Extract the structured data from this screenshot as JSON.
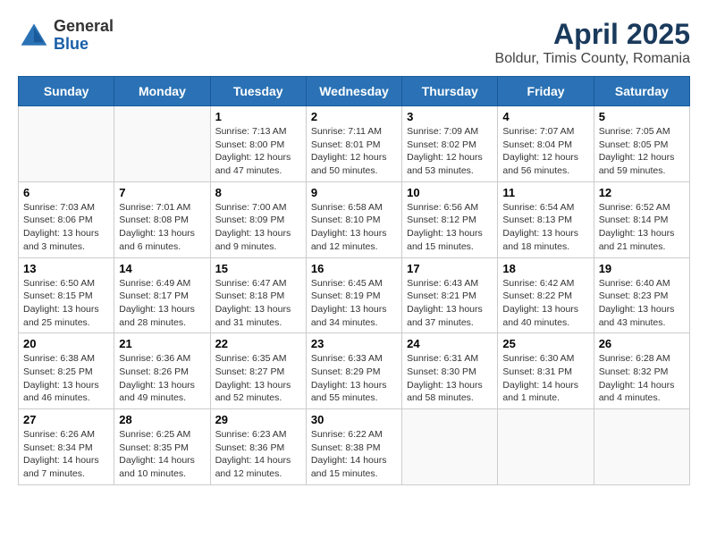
{
  "header": {
    "logo_general": "General",
    "logo_blue": "Blue",
    "title": "April 2025",
    "subtitle": "Boldur, Timis County, Romania"
  },
  "weekdays": [
    "Sunday",
    "Monday",
    "Tuesday",
    "Wednesday",
    "Thursday",
    "Friday",
    "Saturday"
  ],
  "weeks": [
    [
      {
        "day": "",
        "info": ""
      },
      {
        "day": "",
        "info": ""
      },
      {
        "day": "1",
        "sunrise": "7:13 AM",
        "sunset": "8:00 PM",
        "daylight": "12 hours and 47 minutes."
      },
      {
        "day": "2",
        "sunrise": "7:11 AM",
        "sunset": "8:01 PM",
        "daylight": "12 hours and 50 minutes."
      },
      {
        "day": "3",
        "sunrise": "7:09 AM",
        "sunset": "8:02 PM",
        "daylight": "12 hours and 53 minutes."
      },
      {
        "day": "4",
        "sunrise": "7:07 AM",
        "sunset": "8:04 PM",
        "daylight": "12 hours and 56 minutes."
      },
      {
        "day": "5",
        "sunrise": "7:05 AM",
        "sunset": "8:05 PM",
        "daylight": "12 hours and 59 minutes."
      }
    ],
    [
      {
        "day": "6",
        "sunrise": "7:03 AM",
        "sunset": "8:06 PM",
        "daylight": "13 hours and 3 minutes."
      },
      {
        "day": "7",
        "sunrise": "7:01 AM",
        "sunset": "8:08 PM",
        "daylight": "13 hours and 6 minutes."
      },
      {
        "day": "8",
        "sunrise": "7:00 AM",
        "sunset": "8:09 PM",
        "daylight": "13 hours and 9 minutes."
      },
      {
        "day": "9",
        "sunrise": "6:58 AM",
        "sunset": "8:10 PM",
        "daylight": "13 hours and 12 minutes."
      },
      {
        "day": "10",
        "sunrise": "6:56 AM",
        "sunset": "8:12 PM",
        "daylight": "13 hours and 15 minutes."
      },
      {
        "day": "11",
        "sunrise": "6:54 AM",
        "sunset": "8:13 PM",
        "daylight": "13 hours and 18 minutes."
      },
      {
        "day": "12",
        "sunrise": "6:52 AM",
        "sunset": "8:14 PM",
        "daylight": "13 hours and 21 minutes."
      }
    ],
    [
      {
        "day": "13",
        "sunrise": "6:50 AM",
        "sunset": "8:15 PM",
        "daylight": "13 hours and 25 minutes."
      },
      {
        "day": "14",
        "sunrise": "6:49 AM",
        "sunset": "8:17 PM",
        "daylight": "13 hours and 28 minutes."
      },
      {
        "day": "15",
        "sunrise": "6:47 AM",
        "sunset": "8:18 PM",
        "daylight": "13 hours and 31 minutes."
      },
      {
        "day": "16",
        "sunrise": "6:45 AM",
        "sunset": "8:19 PM",
        "daylight": "13 hours and 34 minutes."
      },
      {
        "day": "17",
        "sunrise": "6:43 AM",
        "sunset": "8:21 PM",
        "daylight": "13 hours and 37 minutes."
      },
      {
        "day": "18",
        "sunrise": "6:42 AM",
        "sunset": "8:22 PM",
        "daylight": "13 hours and 40 minutes."
      },
      {
        "day": "19",
        "sunrise": "6:40 AM",
        "sunset": "8:23 PM",
        "daylight": "13 hours and 43 minutes."
      }
    ],
    [
      {
        "day": "20",
        "sunrise": "6:38 AM",
        "sunset": "8:25 PM",
        "daylight": "13 hours and 46 minutes."
      },
      {
        "day": "21",
        "sunrise": "6:36 AM",
        "sunset": "8:26 PM",
        "daylight": "13 hours and 49 minutes."
      },
      {
        "day": "22",
        "sunrise": "6:35 AM",
        "sunset": "8:27 PM",
        "daylight": "13 hours and 52 minutes."
      },
      {
        "day": "23",
        "sunrise": "6:33 AM",
        "sunset": "8:29 PM",
        "daylight": "13 hours and 55 minutes."
      },
      {
        "day": "24",
        "sunrise": "6:31 AM",
        "sunset": "8:30 PM",
        "daylight": "13 hours and 58 minutes."
      },
      {
        "day": "25",
        "sunrise": "6:30 AM",
        "sunset": "8:31 PM",
        "daylight": "14 hours and 1 minute."
      },
      {
        "day": "26",
        "sunrise": "6:28 AM",
        "sunset": "8:32 PM",
        "daylight": "14 hours and 4 minutes."
      }
    ],
    [
      {
        "day": "27",
        "sunrise": "6:26 AM",
        "sunset": "8:34 PM",
        "daylight": "14 hours and 7 minutes."
      },
      {
        "day": "28",
        "sunrise": "6:25 AM",
        "sunset": "8:35 PM",
        "daylight": "14 hours and 10 minutes."
      },
      {
        "day": "29",
        "sunrise": "6:23 AM",
        "sunset": "8:36 PM",
        "daylight": "14 hours and 12 minutes."
      },
      {
        "day": "30",
        "sunrise": "6:22 AM",
        "sunset": "8:38 PM",
        "daylight": "14 hours and 15 minutes."
      },
      {
        "day": "",
        "info": ""
      },
      {
        "day": "",
        "info": ""
      },
      {
        "day": "",
        "info": ""
      }
    ]
  ]
}
